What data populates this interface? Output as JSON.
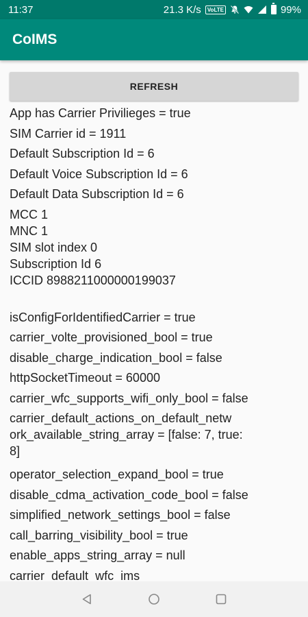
{
  "status_bar": {
    "time": "11:37",
    "network_speed": "21.3 K/s",
    "volte_label": "VoLTE",
    "battery": "99%"
  },
  "app_bar": {
    "title": "CoIMS"
  },
  "refresh_button": {
    "label": "REFRESH"
  },
  "info": {
    "carrier_privileges": "App has Carrier Privilieges = true",
    "sim_carrier_id": "SIM Carrier id = 1911",
    "default_subscription": "Default Subscription Id = 6",
    "default_voice_subscription": "Default Voice Subscription Id = 6",
    "default_data_subscription": "Default Data Subscription Id = 6",
    "mcc": "MCC 1",
    "mnc": "MNC 1",
    "sim_slot_index": "SIM slot index 0",
    "subscription_id": "Subscription Id 6",
    "iccid": "ICCID 8988211000000199037"
  },
  "config": [
    "isConfigForIdentifiedCarrier = true",
    "carrier_volte_provisioned_bool = true",
    "disable_charge_indication_bool = false",
    "httpSocketTimeout = 60000",
    "carrier_wfc_supports_wifi_only_bool = false",
    "carrier_default_actions_on_default_netw",
    "ork_available_string_array = [false: 7, true:",
    "8]",
    "operator_selection_expand_bool = true",
    "disable_cdma_activation_code_bool = false",
    "simplified_network_settings_bool = false",
    "call_barring_visibility_bool = true",
    "enable_apps_string_array = null",
    "carrier_default_wfc_ims"
  ]
}
